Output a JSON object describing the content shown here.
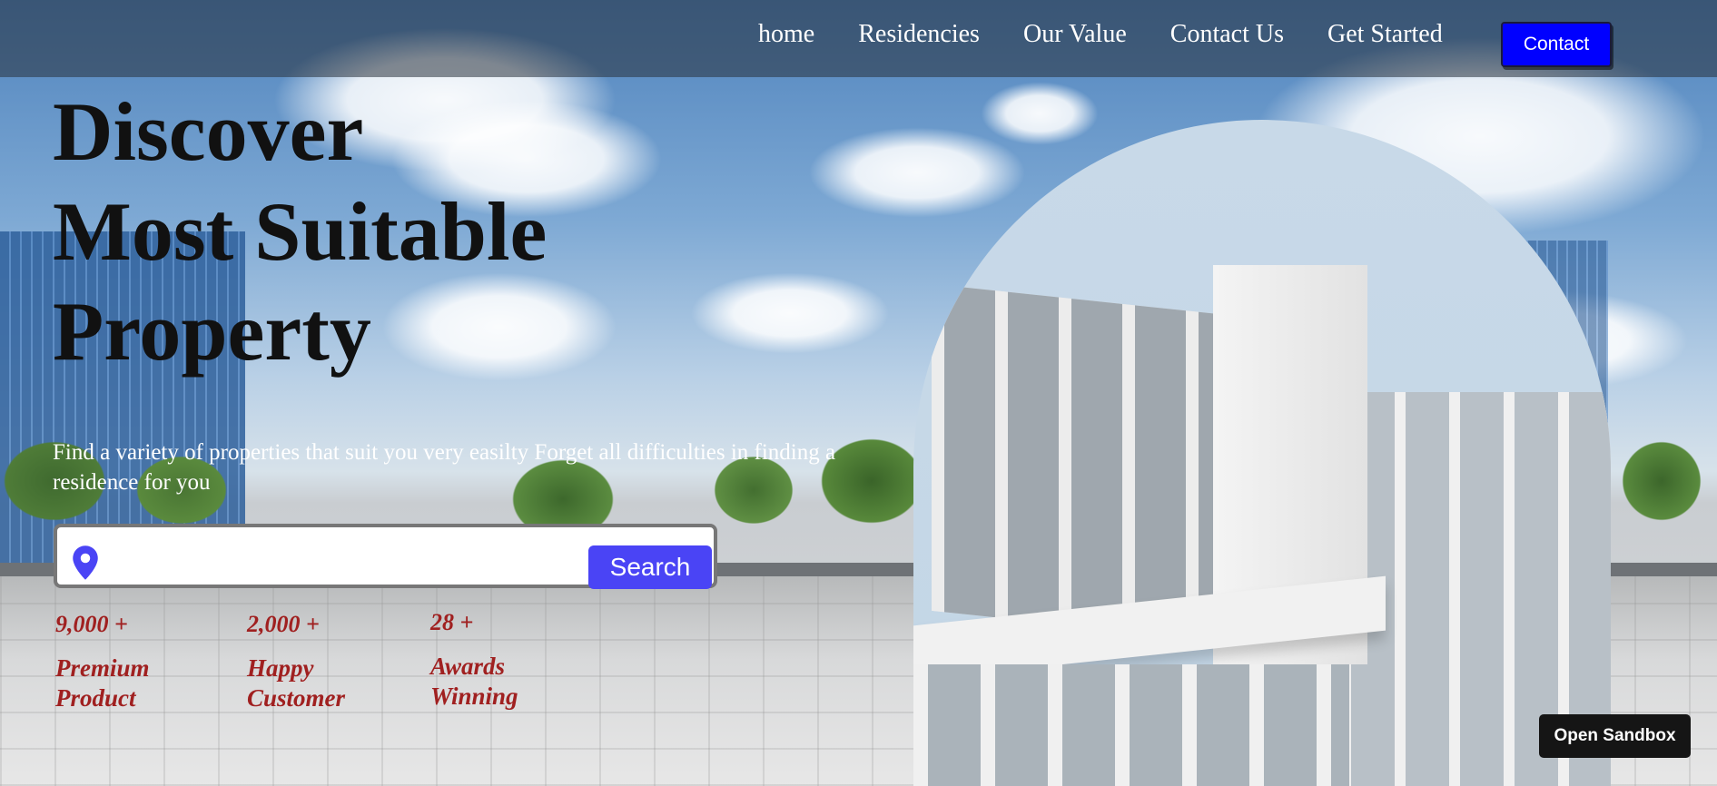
{
  "nav": {
    "links": [
      "home",
      "Residencies",
      "Our Value",
      "Contact Us",
      "Get Started"
    ],
    "contact_button": "Contact"
  },
  "hero": {
    "title_lines": [
      "Discover",
      "Most Suitable",
      "Property"
    ],
    "description": "Find a variety of properties that suit you very easilty Forget all difficulties in finding a residence for you"
  },
  "search": {
    "icon": "location-pin-icon",
    "placeholder": "",
    "button_label": "Search"
  },
  "stats": [
    {
      "number": "9,000 +",
      "label": "Premium Product"
    },
    {
      "number": "2,000 +",
      "label": "Happy Customer"
    },
    {
      "number": "28 +",
      "label": "Awards Winning"
    }
  ],
  "sandbox_button": "Open Sandbox",
  "colors": {
    "contact_button": "#0000ff",
    "search_button": "#4a44f5",
    "stats_text": "#a02020",
    "pin_icon": "#4a44f5"
  }
}
